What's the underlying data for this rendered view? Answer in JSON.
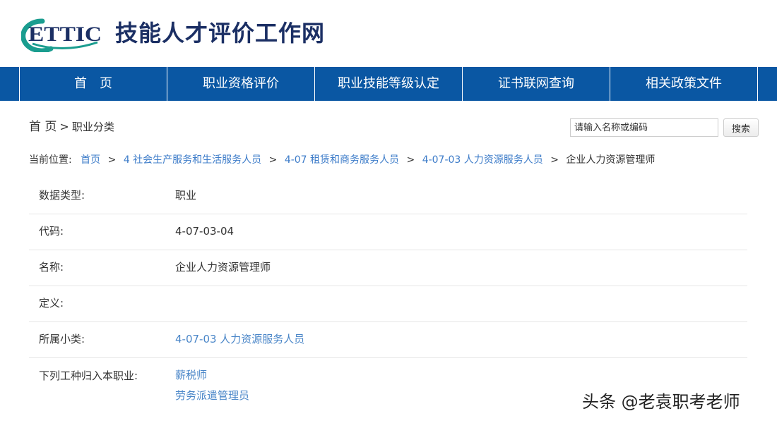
{
  "header": {
    "logo_text": "ETTIC",
    "site_title": "技能人才评价工作网"
  },
  "nav": {
    "items": [
      {
        "label": "首　页"
      },
      {
        "label": "职业资格评价"
      },
      {
        "label": "职业技能等级认定"
      },
      {
        "label": "证书联网查询"
      },
      {
        "label": "相关政策文件"
      }
    ]
  },
  "section": {
    "home": "首 页",
    "separator": ">",
    "label": "职业分类"
  },
  "search": {
    "placeholder": "请输入名称或编码",
    "button_label": "搜索"
  },
  "breadcrumb": {
    "label": "当前位置:",
    "separator": ">",
    "links": [
      "首页",
      "4 社会生产服务和生活服务人员",
      "4-07 租赁和商务服务人员",
      "4-07-03 人力资源服务人员"
    ],
    "current": "企业人力资源管理师"
  },
  "detail": {
    "rows": [
      {
        "label": "数据类型:",
        "value": "职业"
      },
      {
        "label": "代码:",
        "value": "4-07-03-04"
      },
      {
        "label": "名称:",
        "value": "企业人力资源管理师"
      },
      {
        "label": "定义:",
        "value": ""
      },
      {
        "label": "所属小类:",
        "value": "4-07-03 人力资源服务人员"
      },
      {
        "label": "下列工种归入本职业:",
        "values": [
          "薪税师",
          "劳务派遣管理员"
        ]
      }
    ]
  },
  "watermark": "头条 @老袁职考老师",
  "colors": {
    "nav_bg": "#0a57a3",
    "title": "#1b2f64",
    "link": "#4a86c8",
    "logo_teal": "#1a9d8f"
  }
}
